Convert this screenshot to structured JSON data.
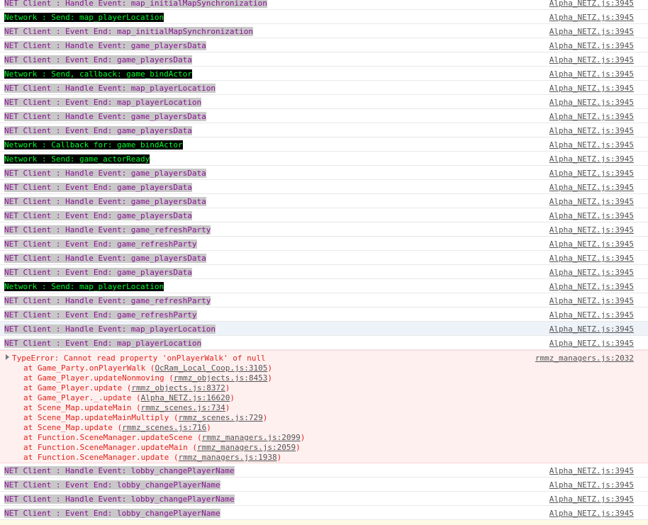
{
  "colors": {
    "net_bg": "#c8c8c8",
    "net_fg": "#881391",
    "network_bg": "#000000",
    "network_fg": "#00ff2a",
    "error_fg": "#e0241b",
    "error_bg": "#fff0f0"
  },
  "logs_before": [
    {
      "type": "net",
      "text": "NET Client : Handle Event: map_initialMapSynchronization",
      "source": "Alpha_NETZ.js:3945"
    },
    {
      "type": "network",
      "text": "Network : Send: map_playerLocation",
      "source": "Alpha_NETZ.js:3945"
    },
    {
      "type": "net",
      "text": "NET Client : Event End: map_initialMapSynchronization",
      "source": "Alpha_NETZ.js:3945"
    },
    {
      "type": "net",
      "text": "NET Client : Handle Event: game_playersData",
      "source": "Alpha_NETZ.js:3945"
    },
    {
      "type": "net",
      "text": "NET Client : Event End: game_playersData",
      "source": "Alpha_NETZ.js:3945"
    },
    {
      "type": "network",
      "text": "Network : Send, callback: game_bindActor",
      "source": "Alpha_NETZ.js:3945"
    },
    {
      "type": "net",
      "text": "NET Client : Handle Event: map_playerLocation",
      "source": "Alpha_NETZ.js:3945"
    },
    {
      "type": "net",
      "text": "NET Client : Event End: map_playerLocation",
      "source": "Alpha_NETZ.js:3945"
    },
    {
      "type": "net",
      "text": "NET Client : Handle Event: game_playersData",
      "source": "Alpha_NETZ.js:3945"
    },
    {
      "type": "net",
      "text": "NET Client : Event End: game_playersData",
      "source": "Alpha_NETZ.js:3945"
    },
    {
      "type": "network",
      "text": "Network : Callback for: game_bindActor",
      "source": "Alpha_NETZ.js:3945"
    },
    {
      "type": "network",
      "text": "Network : Send: game_actorReady",
      "source": "Alpha_NETZ.js:3945"
    },
    {
      "type": "net",
      "text": "NET Client : Handle Event: game_playersData",
      "source": "Alpha_NETZ.js:3945"
    },
    {
      "type": "net",
      "text": "NET Client : Event End: game_playersData",
      "source": "Alpha_NETZ.js:3945"
    },
    {
      "type": "net",
      "text": "NET Client : Handle Event: game_playersData",
      "source": "Alpha_NETZ.js:3945"
    },
    {
      "type": "net",
      "text": "NET Client : Event End: game_playersData",
      "source": "Alpha_NETZ.js:3945"
    },
    {
      "type": "net",
      "text": "NET Client : Handle Event: game_refreshParty",
      "source": "Alpha_NETZ.js:3945"
    },
    {
      "type": "net",
      "text": "NET Client : Event End: game_refreshParty",
      "source": "Alpha_NETZ.js:3945"
    },
    {
      "type": "net",
      "text": "NET Client : Handle Event: game_playersData",
      "source": "Alpha_NETZ.js:3945"
    },
    {
      "type": "net",
      "text": "NET Client : Event End: game_playersData",
      "source": "Alpha_NETZ.js:3945"
    },
    {
      "type": "network",
      "text": "Network : Send: map_playerLocation",
      "source": "Alpha_NETZ.js:3945"
    },
    {
      "type": "net",
      "text": "NET Client : Handle Event: game_refreshParty",
      "source": "Alpha_NETZ.js:3945"
    },
    {
      "type": "net",
      "text": "NET Client : Event End: game_refreshParty",
      "source": "Alpha_NETZ.js:3945"
    },
    {
      "type": "net",
      "text": "NET Client : Handle Event: map_playerLocation",
      "source": "Alpha_NETZ.js:3945",
      "selected": true
    },
    {
      "type": "net",
      "text": "NET Client : Event End: map_playerLocation",
      "source": "Alpha_NETZ.js:3945"
    }
  ],
  "error": {
    "message": "TypeError: Cannot read property 'onPlayerWalk' of null",
    "source": "rmmz_managers.js:2032",
    "stack": [
      {
        "at": "at Game_Party.onPlayerWalk (",
        "link": "OcRam_Local_Coop.js:3105",
        "end": ")"
      },
      {
        "at": "at Game_Player.updateNonmoving (",
        "link": "rmmz_objects.js:8453",
        "end": ")"
      },
      {
        "at": "at Game_Player.update (",
        "link": "rmmz_objects.js:8372",
        "end": ")"
      },
      {
        "at": "at Game_Player._.update (",
        "link": "Alpha_NETZ.js:16620",
        "end": ")"
      },
      {
        "at": "at Scene_Map.updateMain (",
        "link": "rmmz_scenes.js:734",
        "end": ")"
      },
      {
        "at": "at Scene_Map.updateMainMultiply (",
        "link": "rmmz_scenes.js:729",
        "end": ")"
      },
      {
        "at": "at Scene_Map.update (",
        "link": "rmmz_scenes.js:716",
        "end": ")"
      },
      {
        "at": "at Function.SceneManager.updateScene (",
        "link": "rmmz_managers.js:2099",
        "end": ")"
      },
      {
        "at": "at Function.SceneManager.updateMain (",
        "link": "rmmz_managers.js:2059",
        "end": ")"
      },
      {
        "at": "at Function.SceneManager.update (",
        "link": "rmmz_managers.js:1938",
        "end": ")"
      }
    ]
  },
  "logs_after": [
    {
      "type": "net",
      "text": "NET Client : Handle Event: lobby_changePlayerName",
      "source": "Alpha_NETZ.js:3945"
    },
    {
      "type": "net",
      "text": "NET Client : Event End: lobby_changePlayerName",
      "source": "Alpha_NETZ.js:3945"
    },
    {
      "type": "net",
      "text": "NET Client : Handle Event: lobby_changePlayerName",
      "source": "Alpha_NETZ.js:3945"
    },
    {
      "type": "net",
      "text": "NET Client : Event End: lobby_changePlayerName",
      "source": "Alpha_NETZ.js:3945"
    }
  ]
}
